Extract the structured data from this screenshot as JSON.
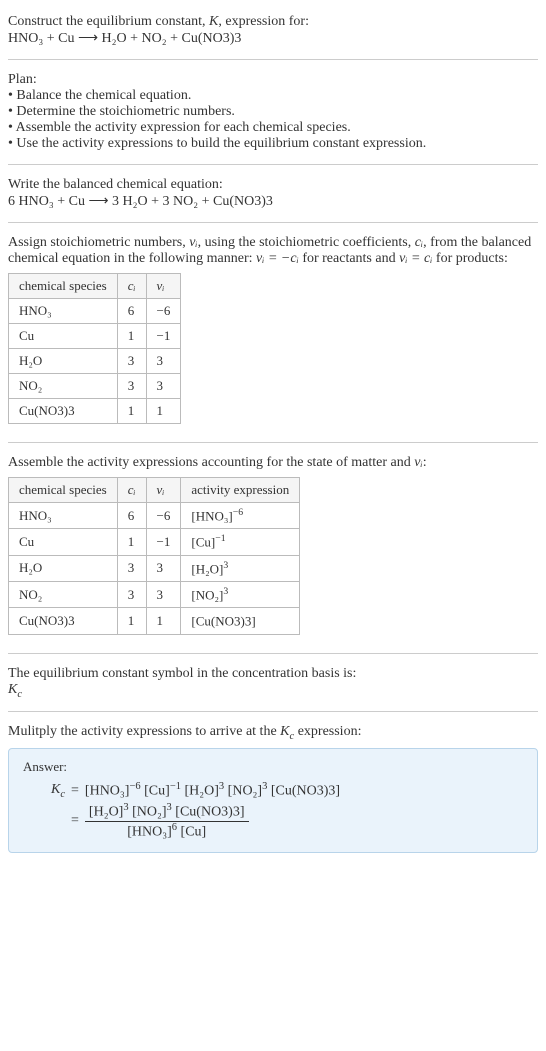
{
  "intro": {
    "line1_a": "Construct the equilibrium constant, ",
    "line1_K": "K",
    "line1_b": ", expression for:",
    "eq": "HNO₃ + Cu ⟶ H₂O + NO₂ + Cu(NO3)3"
  },
  "plan": {
    "heading": "Plan:",
    "items": [
      "• Balance the chemical equation.",
      "• Determine the stoichiometric numbers.",
      "• Assemble the activity expression for each chemical species.",
      "• Use the activity expressions to build the equilibrium constant expression."
    ]
  },
  "balanced": {
    "heading": "Write the balanced chemical equation:",
    "eq": "6 HNO₃ + Cu ⟶ 3 H₂O + 3 NO₂ + Cu(NO3)3"
  },
  "stoich": {
    "text_a": "Assign stoichiometric numbers, ",
    "nu": "νᵢ",
    "text_b": ", using the stoichiometric coefficients, ",
    "ci": "cᵢ",
    "text_c": ", from the balanced chemical equation in the following manner: ",
    "rel1": "νᵢ = −cᵢ",
    "text_d": " for reactants and ",
    "rel2": "νᵢ = cᵢ",
    "text_e": " for products:",
    "headers": [
      "chemical species",
      "cᵢ",
      "νᵢ"
    ],
    "rows": [
      [
        "HNO₃",
        "6",
        "−6"
      ],
      [
        "Cu",
        "1",
        "−1"
      ],
      [
        "H₂O",
        "3",
        "3"
      ],
      [
        "NO₂",
        "3",
        "3"
      ],
      [
        "Cu(NO3)3",
        "1",
        "1"
      ]
    ]
  },
  "activity": {
    "text_a": "Assemble the activity expressions accounting for the state of matter and ",
    "nu": "νᵢ",
    "text_b": ":",
    "headers": [
      "chemical species",
      "cᵢ",
      "νᵢ",
      "activity expression"
    ],
    "rows": [
      {
        "sp": "HNO₃",
        "c": "6",
        "v": "−6",
        "act_base": "[HNO₃]",
        "act_exp": "−6"
      },
      {
        "sp": "Cu",
        "c": "1",
        "v": "−1",
        "act_base": "[Cu]",
        "act_exp": "−1"
      },
      {
        "sp": "H₂O",
        "c": "3",
        "v": "3",
        "act_base": "[H₂O]",
        "act_exp": "3"
      },
      {
        "sp": "NO₂",
        "c": "3",
        "v": "3",
        "act_base": "[NO₂]",
        "act_exp": "3"
      },
      {
        "sp": "Cu(NO3)3",
        "c": "1",
        "v": "1",
        "act_base": "[Cu(NO3)3]",
        "act_exp": ""
      }
    ]
  },
  "symbol": {
    "text": "The equilibrium constant symbol in the concentration basis is:",
    "sym_base": "K",
    "sym_sub": "c"
  },
  "multiply": {
    "text_a": "Mulitply the activity expressions to arrive at the ",
    "kc_base": "K",
    "kc_sub": "c",
    "text_b": " expression:"
  },
  "answer": {
    "label": "Answer:",
    "lhs_base": "K",
    "lhs_sub": "c",
    "eq_sign": " = ",
    "prod_terms": [
      {
        "base": "[HNO₃]",
        "exp": "−6"
      },
      {
        "base": "[Cu]",
        "exp": "−1"
      },
      {
        "base": "[H₂O]",
        "exp": "3"
      },
      {
        "base": "[NO₂]",
        "exp": "3"
      },
      {
        "base": "[Cu(NO3)3]",
        "exp": ""
      }
    ],
    "frac_num": [
      {
        "base": "[H₂O]",
        "exp": "3"
      },
      {
        "base": "[NO₂]",
        "exp": "3"
      },
      {
        "base": "[Cu(NO3)3]",
        "exp": ""
      }
    ],
    "frac_den": [
      {
        "base": "[HNO₃]",
        "exp": "6"
      },
      {
        "base": "[Cu]",
        "exp": ""
      }
    ]
  }
}
